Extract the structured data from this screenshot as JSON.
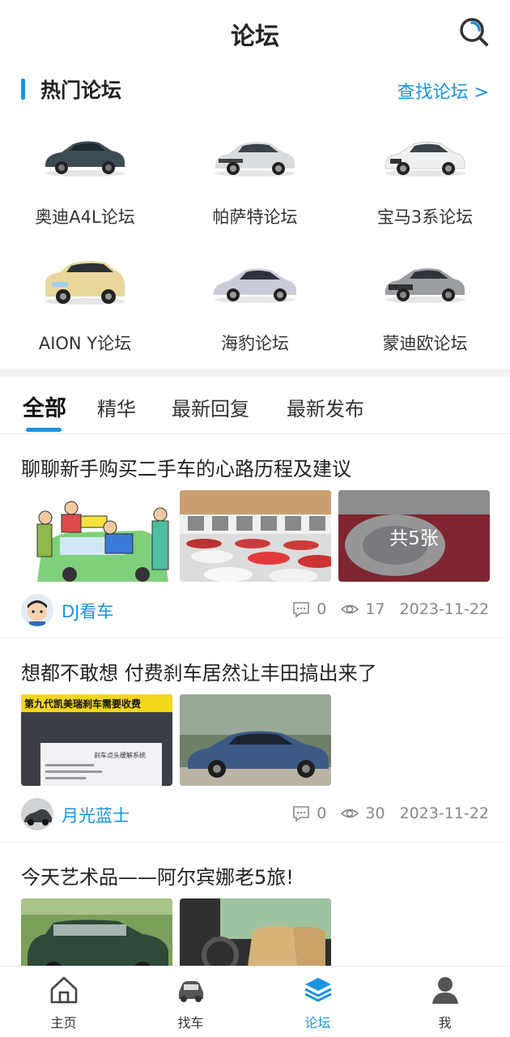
{
  "header": {
    "title": "论坛"
  },
  "hot": {
    "title": "热门论坛",
    "find_link": "查找论坛 >",
    "forums": [
      {
        "label": "奥迪A4L论坛",
        "color": "#3d4b52"
      },
      {
        "label": "帕萨特论坛",
        "color": "#d9dcdf"
      },
      {
        "label": "宝马3系论坛",
        "color": "#eef0f2"
      },
      {
        "label": "AION Y论坛",
        "color": "#e8d79a"
      },
      {
        "label": "海豹论坛",
        "color": "#c9ccd8"
      },
      {
        "label": "蒙迪欧论坛",
        "color": "#9a9ea3"
      }
    ]
  },
  "tabs": [
    "全部",
    "精华",
    "最新回复",
    "最新发布"
  ],
  "posts": [
    {
      "title": "聊聊新手购买二手车的心路历程及建议",
      "author": "DJ看车",
      "comments": "0",
      "views": "17",
      "date": "2023-11-22",
      "more_label": "共5张"
    },
    {
      "title": "想都不敢想 付费刹车居然让丰田搞出来了",
      "author": "月光蓝士",
      "comments": "0",
      "views": "30",
      "date": "2023-11-22",
      "banner_text": "第九代凯美瑞刹车需要收费",
      "dialog_text": "刹车点头缓解系统"
    },
    {
      "title": "今天艺术品——阿尔宾娜老5旅!"
    }
  ],
  "nav": [
    {
      "label": "主页",
      "icon": "home-icon"
    },
    {
      "label": "找车",
      "icon": "car-icon"
    },
    {
      "label": "论坛",
      "icon": "forum-icon"
    },
    {
      "label": "我",
      "icon": "user-icon"
    }
  ],
  "colors": {
    "accent": "#1a93e0",
    "text": "#222222",
    "muted": "#888888"
  }
}
